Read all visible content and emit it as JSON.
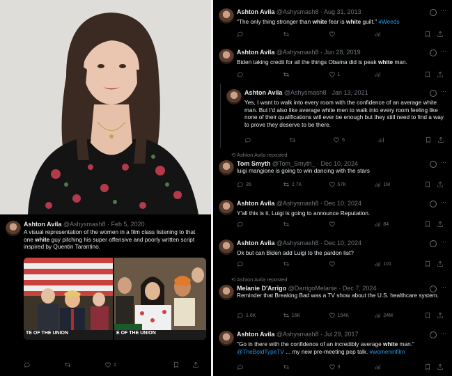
{
  "left_tweet": {
    "name": "Ashton Avila",
    "handle": "@Ashysmash8",
    "date": "· Feb 5, 2020",
    "text_a": "A visual representation of the women in a film class listening to that one ",
    "text_hl": "white",
    "text_b": " guy pitching his super offensive and poorly written script inspired by Quentin Tarantino.",
    "media_caption_left": "TE OF THE UNION",
    "media_caption_right": "E OF THE UNION",
    "likes": "2"
  },
  "tweets": [
    {
      "name": "Ashton Avila",
      "handle": "@Ashysmash8",
      "date": "· Aug 31, 2013",
      "parts": [
        {
          "t": "\"The only thing stronger than ",
          "s": ""
        },
        {
          "t": "white",
          "s": "hl"
        },
        {
          "t": " fear is ",
          "s": ""
        },
        {
          "t": "white",
          "s": "hl"
        },
        {
          "t": " guilt.\" ",
          "s": ""
        },
        {
          "t": "#Weeds",
          "s": "link"
        }
      ],
      "stats": {
        "reply": "",
        "repost": "",
        "like": "",
        "views": ""
      }
    },
    {
      "name": "Ashton Avila",
      "handle": "@Ashysmash8",
      "date": "· Jun 28, 2019",
      "parts": [
        {
          "t": "Biden taking credit for all the things Obama did is peak ",
          "s": ""
        },
        {
          "t": "white",
          "s": "hl"
        },
        {
          "t": " man.",
          "s": ""
        }
      ],
      "stats": {
        "reply": "",
        "repost": "",
        "like": "1",
        "views": ""
      }
    },
    {
      "name": "Ashton Avila",
      "handle": "@Ashysmash8",
      "date": "· Jan 13, 2021",
      "parts": [
        {
          "t": "Yes, I want to walk into every room with the confidence of an average white man. But I'd also like average white men to walk into every room feeling like none of their qualifications will ever be enough but they still need to find a way to prove they deserve to be there.",
          "s": ""
        }
      ],
      "stats": {
        "reply": "",
        "repost": "",
        "like": "6",
        "views": ""
      }
    },
    {
      "repost_by": "Ashton Avila reposted",
      "name": "Tom Smyth",
      "handle": "@Tom_Smyth_",
      "date": "· Dec 10, 2024",
      "parts": [
        {
          "t": "luigi mangione is going to win dancing with the stars",
          "s": ""
        }
      ],
      "stats": {
        "reply": "35",
        "repost": "2.7K",
        "like": "57K",
        "views": "1M"
      }
    },
    {
      "name": "Ashton Avila",
      "handle": "@Ashysmash8",
      "date": "· Dec 10, 2024",
      "parts": [
        {
          "t": "Y'all this is it. Luigi is going to announce Reputation.",
          "s": ""
        }
      ],
      "stats": {
        "reply": "",
        "repost": "",
        "like": "",
        "views": "84"
      }
    },
    {
      "name": "Ashton Avila",
      "handle": "@Ashysmash8",
      "date": "· Dec 10, 2024",
      "parts": [
        {
          "t": "Ok but can Biden add Luigi to the pardon list?",
          "s": ""
        }
      ],
      "stats": {
        "reply": "",
        "repost": "",
        "like": "",
        "views": "101"
      }
    },
    {
      "repost_by": "Ashton Avila reposted",
      "name": "Melanie D'Arrigo",
      "handle": "@DarrigoMelanie",
      "date": "· Dec 7, 2024",
      "parts": [
        {
          "t": "Reminder that Breaking Bad was a TV show about the U.S. healthcare system.",
          "s": ""
        }
      ],
      "stats": {
        "reply": "1.6K",
        "repost": "16K",
        "like": "154K",
        "views": "24M"
      }
    },
    {
      "name": "Ashton Avila",
      "handle": "@Ashysmash8",
      "date": "· Jul 29, 2017",
      "parts": [
        {
          "t": "\"Go in there with the confidence of an incredibly average ",
          "s": ""
        },
        {
          "t": "white",
          "s": "hl"
        },
        {
          "t": " man.\" ",
          "s": ""
        },
        {
          "t": "@TheBoldTypeTV",
          "s": "link"
        },
        {
          "t": " ... my new pre-meeting pep talk. ",
          "s": ""
        },
        {
          "t": "#womeninfilm",
          "s": "link"
        }
      ],
      "stats": {
        "reply": "",
        "repost": "",
        "like": "3",
        "views": ""
      }
    }
  ]
}
